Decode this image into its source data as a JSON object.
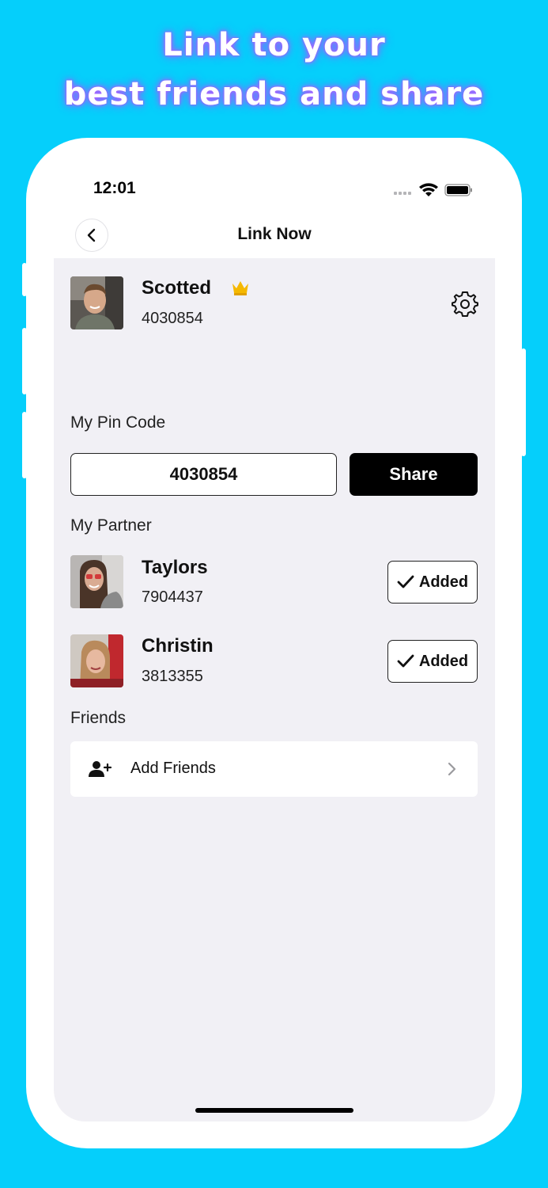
{
  "promo": {
    "line1": "Link to your",
    "line2": "best friends and share"
  },
  "status_bar": {
    "time": "12:01"
  },
  "nav": {
    "title": "Link Now"
  },
  "profile": {
    "name": "Scotted",
    "id": "4030854",
    "badge": "crown-icon"
  },
  "pin": {
    "label": "My Pin Code",
    "code": "4030854",
    "share_label": "Share"
  },
  "partners": {
    "label": "My Partner",
    "items": [
      {
        "name": "Taylors",
        "id": "7904437",
        "status": "Added"
      },
      {
        "name": "Christin",
        "id": "3813355",
        "status": "Added"
      }
    ]
  },
  "friends": {
    "label": "Friends",
    "add_label": "Add Friends"
  },
  "colors": {
    "background": "#05cffb",
    "content_bg": "#f1f0f5",
    "accent_crown": "#f5b800"
  }
}
